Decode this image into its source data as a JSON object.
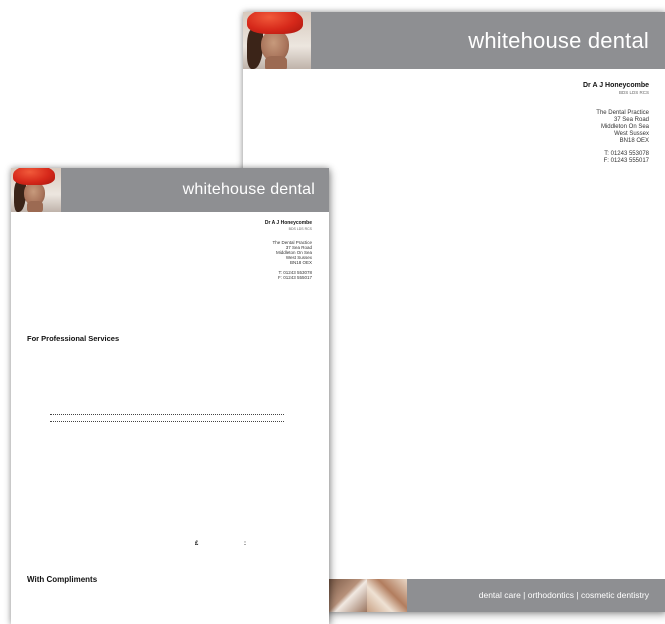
{
  "brand": "whitehouse dental",
  "practitioner": {
    "name": "Dr A J Honeycombe",
    "qualifications": "BDS LDS RCS"
  },
  "address": {
    "line1": "The Dental Practice",
    "line2": "37 Sea Road",
    "line3": "Middleton On Sea",
    "line4": "West Sussex",
    "line5": "BN18 OEX"
  },
  "contact": {
    "telephone": "T: 01243 553078",
    "fax": "F: 01243 555017"
  },
  "letterhead": {
    "footer_tagline": "dental care | orthodontics | cosmetic dentistry"
  },
  "slip": {
    "heading": "For Professional Services",
    "currency_symbol": "£",
    "separator": ":",
    "compliments": "With Compliments"
  },
  "colors": {
    "band": "#8e8f92",
    "hat": "#d6281a",
    "text": "#111111"
  }
}
